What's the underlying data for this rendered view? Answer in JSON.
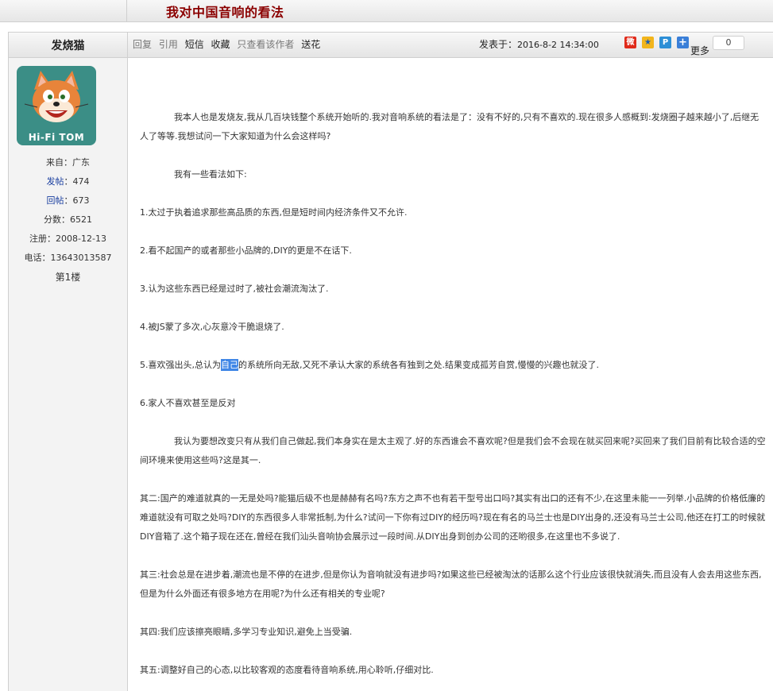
{
  "thread": {
    "title": "我对中国音响的看法"
  },
  "post_header": {
    "author": "发烧猫",
    "actions": [
      "回复",
      "引用",
      "短信",
      "收藏",
      "只查看该作者",
      "送花"
    ],
    "posted_label": "发表于：",
    "posted_time": "2016-8-2 14:34:00",
    "share_icons": [
      "weibo-icon",
      "qzone-icon",
      "tencent-weibo-icon",
      "plus-share-icon"
    ],
    "more_label": "更多",
    "share_count": "0"
  },
  "user": {
    "avatar_text": "Hi-Fi TOM",
    "from_label": "来自：",
    "from": "广东",
    "posts_label": "发帖",
    "posts": "474",
    "replies_label": "回帖",
    "replies": "673",
    "score_label": "分数：",
    "score": "6521",
    "register_label": "注册：",
    "register": "2008-12-13",
    "phone_label": "电话：",
    "phone": "13643013587",
    "floor": "第1楼"
  },
  "content": {
    "p1": "我本人也是发烧友,我从几百块钱整个系统开始听的.我对音响系统的看法是了：没有不好的,只有不喜欢的.现在很多人感概到:发烧圈子越来越小了,后继无人了等等.我想试问一下大家知道为什么会这样吗?",
    "p2": "我有一些看法如下:",
    "l1": "1.太过于执着追求那些高品质的东西,但是短时间内经济条件又不允许.",
    "l2": "2.看不起国产的或者那些小品牌的,DIY的更是不在话下.",
    "l3": "3.认为这些东西已经是过时了,被社会潮流淘汰了.",
    "l4": "4.被JS蒙了多次,心灰意冷干脆退烧了.",
    "l5_pre": "5.喜欢强出头,总认为",
    "l5_hl": "自己",
    "l5_post": "的系统所向无敌,又死不承认大家的系统各有独到之处.结果变成孤芳自赏,慢慢的兴趣也就没了.",
    "l6": "6.家人不喜欢甚至是反对",
    "p3": "我认为要想改变只有从我们自己做起,我们本身实在是太主观了.好的东西谁会不喜欢呢?但是我们会不会现在就买回来呢?买回来了我们目前有比较合适的空间环境来使用这些吗?这是其一.",
    "p4": "其二:国产的难道就真的一无是处吗?能猫后级不也是赫赫有名吗?东方之声不也有若干型号出口吗?其实有出口的还有不少,在这里未能一一列举.小品牌的价格低廉的难道就没有可取之处吗?DIY的东西很多人非常抵制,为什么?试问一下你有过DIY的经历吗?现在有名的马兰士也是DIY出身的,还没有马兰士公司,他还在打工的时候就DIY音箱了.这个箱子现在还在,曾经在我们汕头音响协会展示过一段时间.从DIY出身到创办公司的还哟很多,在这里也不多说了.",
    "p5": "其三:社会总是在进步着,潮流也是不停的在进步,但是你认为音响就没有进步吗?如果这些已经被淘汰的话那么这个行业应该很快就消失,而且没有人会去用这些东西,但是为什么外面还有很多地方在用呢?为什么还有相关的专业呢?",
    "p6": "其四:我们应该擦亮眼睛,多学习专业知识,避免上当受骗.",
    "p7": "其五:调整好自己的心态,以比较客观的态度看待音响系统,用心聆听,仔细对比."
  }
}
